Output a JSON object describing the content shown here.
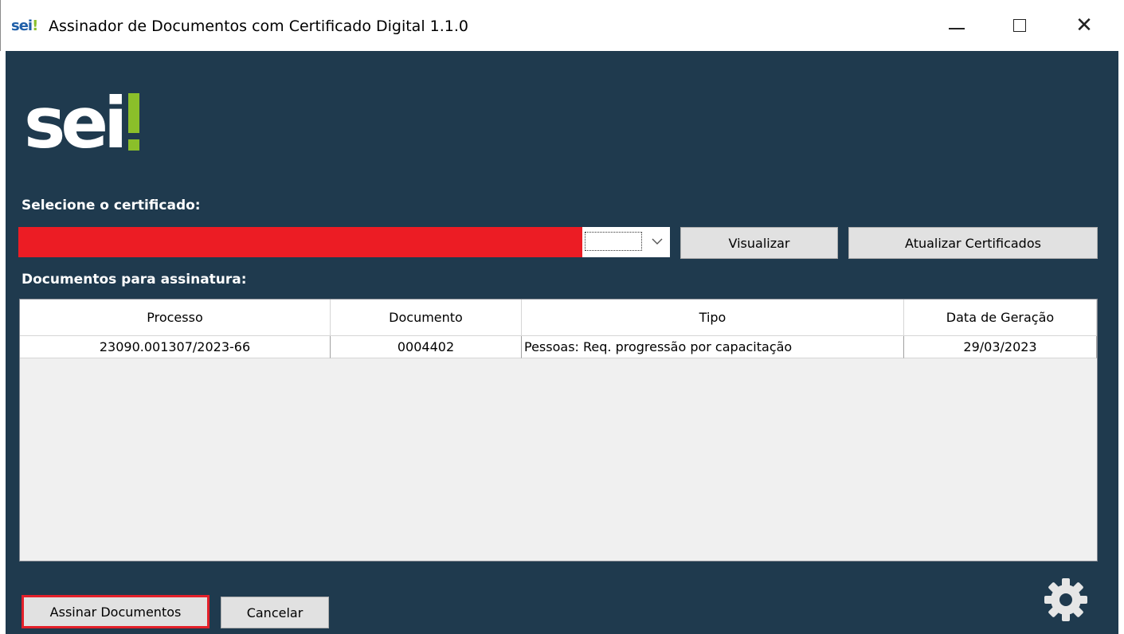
{
  "window": {
    "logo_text": "sei",
    "logo_bang": "!",
    "title": "Assinador de Documentos com Certificado Digital 1.1.0",
    "controls": [
      "minimize-icon",
      "maximize-icon",
      "close-icon"
    ]
  },
  "branding": {
    "logo_text": "sei",
    "accent_color": "#8bbf2a",
    "bg_color": "#1f3a4e"
  },
  "certificate": {
    "label": "Selecione o certificado:",
    "selected_value": "",
    "redacted_color": "#ec1c24",
    "view_button": "Visualizar",
    "refresh_button": "Atualizar Certificados"
  },
  "documents": {
    "label": "Documentos para assinatura:",
    "columns": [
      "Processo",
      "Documento",
      "Tipo",
      "Data de Geração"
    ],
    "rows": [
      [
        "23090.001307/2023-66",
        "0004402",
        "Pessoas: Req. progressão por capacitação",
        "29/03/2023"
      ]
    ]
  },
  "actions": {
    "sign_button": "Assinar Documentos",
    "cancel_button": "Cancelar",
    "settings_icon": "gear-icon"
  }
}
